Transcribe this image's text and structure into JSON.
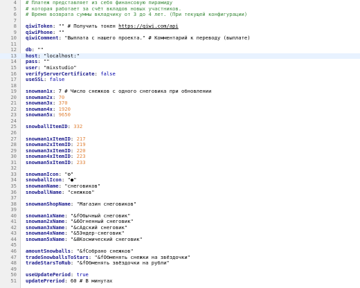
{
  "editor": {
    "first_line_number": 4,
    "active_line_index": 9,
    "colors": {
      "comment": "#3a8a3a",
      "key": "#1a1a8c",
      "number": "#e0833a",
      "boolean": "#0000aa",
      "active_line": "#e8f2ff",
      "gutter": "#f0f0f0"
    },
    "lines": [
      [
        [
          "cm",
          "# Платеж представляет из себя финансовую пирамиду"
        ]
      ],
      [
        [
          "cm",
          "# которая работает за счёт вкладов новых участников."
        ]
      ],
      [
        [
          "cm",
          "# Время возврата суммы вкладчику от 3 до 4 лет. (При текущей конфигурации)"
        ]
      ],
      [],
      [
        [
          "k",
          "qiwiToken"
        ],
        [
          "p",
          ": \"\" # Получить токен "
        ],
        [
          "url",
          "https://qiwi.com/api"
        ]
      ],
      [
        [
          "k",
          "qiwiPhone"
        ],
        [
          "p",
          ": \"\""
        ]
      ],
      [
        [
          "k",
          "qiwiComment"
        ],
        [
          "p",
          ": \"Выплата с нашего проекта.\" # Комментарий к переводу (выплате)"
        ]
      ],
      [],
      [
        [
          "k",
          "db"
        ],
        [
          "p",
          ": \"\""
        ]
      ],
      [
        [
          "k",
          "host"
        ],
        [
          "p",
          ": \"localhost:\""
        ]
      ],
      [
        [
          "k",
          "pass"
        ],
        [
          "p",
          ": \"\""
        ]
      ],
      [
        [
          "k",
          "user"
        ],
        [
          "p",
          ": \"mixstudio\""
        ]
      ],
      [
        [
          "k",
          "verifyServerCertificate"
        ],
        [
          "p",
          ": "
        ],
        [
          "b",
          "false"
        ]
      ],
      [
        [
          "k",
          "useSSL"
        ],
        [
          "p",
          ": "
        ],
        [
          "b",
          "false"
        ]
      ],
      [],
      [
        [
          "k",
          "snowman1x"
        ],
        [
          "p",
          ": 7 # Число снежков с одного снеговика при обновлении"
        ]
      ],
      [
        [
          "k",
          "snowman2x"
        ],
        [
          "p",
          ": "
        ],
        [
          "n",
          "70"
        ]
      ],
      [
        [
          "k",
          "snowman3x"
        ],
        [
          "p",
          ": "
        ],
        [
          "n",
          "370"
        ]
      ],
      [
        [
          "k",
          "snowman4x"
        ],
        [
          "p",
          ": "
        ],
        [
          "n",
          "1920"
        ]
      ],
      [
        [
          "k",
          "snowman5x"
        ],
        [
          "p",
          ": "
        ],
        [
          "n",
          "9650"
        ]
      ],
      [],
      [
        [
          "k",
          "snowballItemID"
        ],
        [
          "p",
          ": "
        ],
        [
          "n",
          "332"
        ]
      ],
      [],
      [
        [
          "k",
          "snowman1xItemID"
        ],
        [
          "p",
          ": "
        ],
        [
          "n",
          "217"
        ]
      ],
      [
        [
          "k",
          "snowman2xItemID"
        ],
        [
          "p",
          ": "
        ],
        [
          "n",
          "219"
        ]
      ],
      [
        [
          "k",
          "snowman3xItemID"
        ],
        [
          "p",
          ": "
        ],
        [
          "n",
          "220"
        ]
      ],
      [
        [
          "k",
          "snowman4xItemID"
        ],
        [
          "p",
          ": "
        ],
        [
          "n",
          "223"
        ]
      ],
      [
        [
          "k",
          "snowman5xItemID"
        ],
        [
          "p",
          ": "
        ],
        [
          "n",
          "233"
        ]
      ],
      [],
      [
        [
          "k",
          "snowmanIcon"
        ],
        [
          "p",
          ": \"⚙\""
        ]
      ],
      [
        [
          "k",
          "snowballIcon"
        ],
        [
          "p",
          ": \"●\""
        ]
      ],
      [
        [
          "k",
          "snowmanName"
        ],
        [
          "p",
          ": \"снеговиков\""
        ]
      ],
      [
        [
          "k",
          "snowballName"
        ],
        [
          "p",
          ": \"снежков\""
        ]
      ],
      [],
      [
        [
          "k",
          "snowmanShopName"
        ],
        [
          "p",
          ": \"Магазин снеговиков\""
        ]
      ],
      [],
      [
        [
          "k",
          "snowman1xName"
        ],
        [
          "p",
          ": \"&fОбычный снеговик\""
        ]
      ],
      [
        [
          "k",
          "snowman2xName"
        ],
        [
          "p",
          ": \"&6Огненный снеговик\""
        ]
      ],
      [
        [
          "k",
          "snowman3xName"
        ],
        [
          "p",
          ": \"&cАдский снеговик\""
        ]
      ],
      [
        [
          "k",
          "snowman4xName"
        ],
        [
          "p",
          ": \"&5Эндер-снеговик\""
        ]
      ],
      [
        [
          "k",
          "snowman5xName"
        ],
        [
          "p",
          ": \"&8Космический снеговик\""
        ]
      ],
      [],
      [
        [
          "k",
          "amountSnowballs"
        ],
        [
          "p",
          ": \"&fСобрано снежков\""
        ]
      ],
      [
        [
          "k",
          "tradeSnowballsToStars"
        ],
        [
          "p",
          ": \"&fОбменять снежки на звёздочки\""
        ]
      ],
      [
        [
          "k",
          "tradeStarsToRub"
        ],
        [
          "p",
          ": \"&fОбменять звёздочки на рубли\""
        ]
      ],
      [],
      [
        [
          "k",
          "useUpdatePeriod"
        ],
        [
          "p",
          ": "
        ],
        [
          "b",
          "true"
        ]
      ],
      [
        [
          "k",
          "updatePreriod"
        ],
        [
          "p",
          ": 60 # В минутах"
        ]
      ]
    ]
  }
}
